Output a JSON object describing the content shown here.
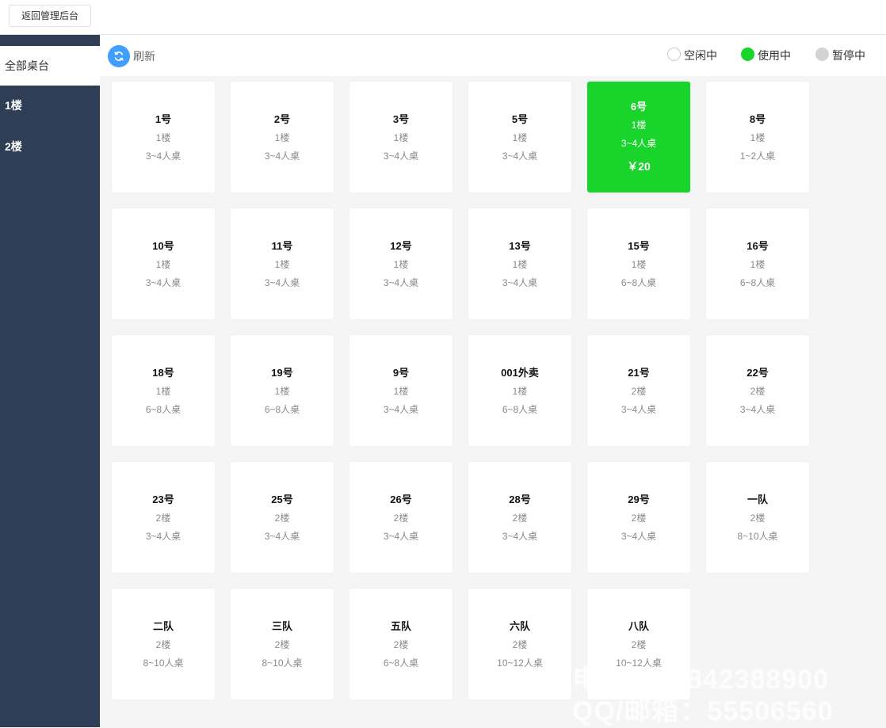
{
  "header": {
    "back_label": "返回管理后台"
  },
  "sidebar": {
    "items": [
      {
        "label": "全部桌台"
      },
      {
        "label": "1楼"
      },
      {
        "label": "2楼"
      }
    ]
  },
  "toolbar": {
    "refresh_label": "刷新",
    "legend": [
      {
        "label": "空闲中",
        "color": "#ffffff"
      },
      {
        "label": "使用中",
        "color": "#19d42a"
      },
      {
        "label": "暂停中",
        "color": "#d3d3d3"
      }
    ]
  },
  "tables": [
    {
      "name": "1号",
      "floor": "1楼",
      "cap": "3~4人桌"
    },
    {
      "name": "2号",
      "floor": "1楼",
      "cap": "3~4人桌"
    },
    {
      "name": "3号",
      "floor": "1楼",
      "cap": "3~4人桌"
    },
    {
      "name": "5号",
      "floor": "1楼",
      "cap": "3~4人桌"
    },
    {
      "name": "6号",
      "floor": "1楼",
      "cap": "3~4人桌",
      "status": "busy",
      "price": "￥20"
    },
    {
      "name": "8号",
      "floor": "1楼",
      "cap": "1~2人桌"
    },
    {
      "name": "10号",
      "floor": "1楼",
      "cap": "3~4人桌"
    },
    {
      "name": "11号",
      "floor": "1楼",
      "cap": "3~4人桌"
    },
    {
      "name": "12号",
      "floor": "1楼",
      "cap": "3~4人桌"
    },
    {
      "name": "13号",
      "floor": "1楼",
      "cap": "3~4人桌"
    },
    {
      "name": "15号",
      "floor": "1楼",
      "cap": "6~8人桌"
    },
    {
      "name": "16号",
      "floor": "1楼",
      "cap": "6~8人桌"
    },
    {
      "name": "18号",
      "floor": "1楼",
      "cap": "6~8人桌"
    },
    {
      "name": "19号",
      "floor": "1楼",
      "cap": "6~8人桌"
    },
    {
      "name": "9号",
      "floor": "1楼",
      "cap": "3~4人桌"
    },
    {
      "name": "001外卖",
      "floor": "1楼",
      "cap": "6~8人桌"
    },
    {
      "name": "21号",
      "floor": "2楼",
      "cap": "3~4人桌"
    },
    {
      "name": "22号",
      "floor": "2楼",
      "cap": "3~4人桌"
    },
    {
      "name": "23号",
      "floor": "2楼",
      "cap": "3~4人桌"
    },
    {
      "name": "25号",
      "floor": "2楼",
      "cap": "3~4人桌"
    },
    {
      "name": "26号",
      "floor": "2楼",
      "cap": "3~4人桌"
    },
    {
      "name": "28号",
      "floor": "2楼",
      "cap": "3~4人桌"
    },
    {
      "name": "29号",
      "floor": "2楼",
      "cap": "3~4人桌"
    },
    {
      "name": "一队",
      "floor": "2楼",
      "cap": "8~10人桌"
    },
    {
      "name": "二队",
      "floor": "2楼",
      "cap": "8~10人桌"
    },
    {
      "name": "三队",
      "floor": "2楼",
      "cap": "8~10人桌"
    },
    {
      "name": "五队",
      "floor": "2楼",
      "cap": "6~8人桌"
    },
    {
      "name": "六队",
      "floor": "2楼",
      "cap": "10~12人桌"
    },
    {
      "name": "八队",
      "floor": "2楼",
      "cap": "10~12人桌"
    }
  ],
  "watermark": {
    "line1": "电话：18842388900",
    "line2": "QQ/邮箱：55506560"
  }
}
